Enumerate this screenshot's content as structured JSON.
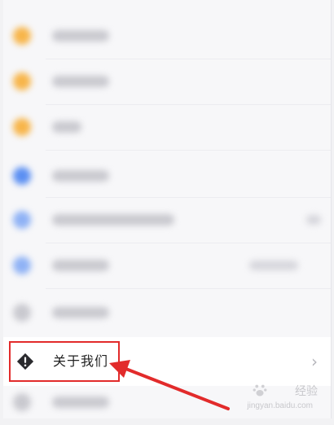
{
  "menu": {
    "about_label": "关于我们",
    "about_icon": "warning-diamond-icon",
    "chevron_icon": "chevron-right-icon"
  },
  "annotation": {
    "highlight_color": "#e22b2b",
    "arrow_color": "#e22b2b"
  },
  "watermark": {
    "logo_icon": "baidu-paw-icon",
    "brand": "经验",
    "url": "jingyan.baidu.com"
  }
}
